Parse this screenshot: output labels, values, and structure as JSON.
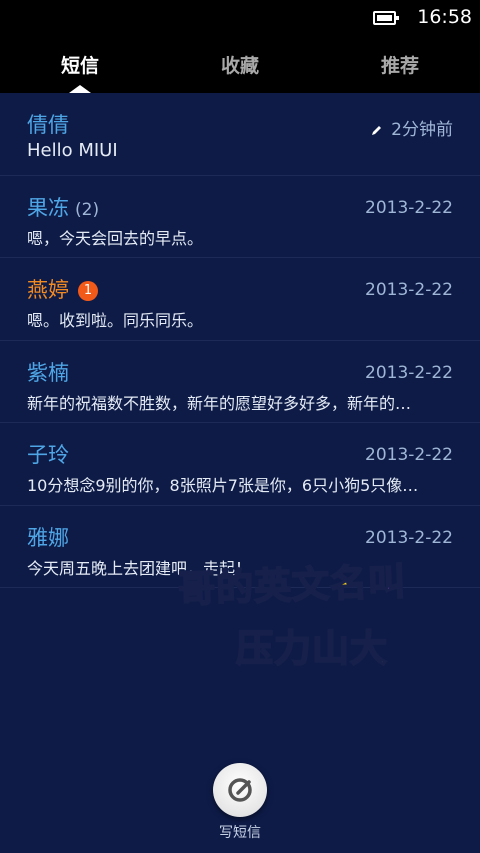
{
  "status_bar": {
    "time": "16:58",
    "battery_icon": "battery-full-icon"
  },
  "tabs": [
    {
      "label": "短信",
      "active": true
    },
    {
      "label": "收藏",
      "active": false
    },
    {
      "label": "推荐",
      "active": false
    }
  ],
  "conversations": [
    {
      "name": "倩倩",
      "count": "",
      "badge": "",
      "time": "2分钟前",
      "draft_icon": "pencil-icon",
      "preview": "Hello MIUI"
    },
    {
      "name": "果冻",
      "count": "(2)",
      "badge": "",
      "time": "2013-2-22",
      "preview": "嗯，今天会回去的早点。"
    },
    {
      "name": "燕婷",
      "count": "",
      "badge": "1",
      "time": "2013-2-22",
      "preview": "嗯。收到啦。同乐同乐。"
    },
    {
      "name": "紫楠",
      "count": "",
      "badge": "",
      "time": "2013-2-22",
      "preview": "新年的祝福数不胜数，新年的愿望好多好多，新年的…"
    },
    {
      "name": "子玲",
      "count": "",
      "badge": "",
      "time": "2013-2-22",
      "preview": "10分想念9别的你，8张照片7张是你，6只小狗5只像…"
    },
    {
      "name": "雅娜",
      "count": "",
      "badge": "",
      "time": "2013-2-22",
      "preview": "今天周五晚上去团建吧，走起！"
    }
  ],
  "overlay": {
    "line1": [
      "哥",
      "的",
      "英",
      "文",
      "名",
      "叫"
    ],
    "line2": [
      "压",
      "力",
      "山",
      "大"
    ],
    "colors1": [
      "#f5a623",
      "#e84393",
      "#8bd645",
      "#2ec4e6",
      "#f5d11a",
      "#b44ee8"
    ],
    "colors2": [
      "#2ec4e6",
      "#f5a623",
      "#e84393",
      "#8bd645"
    ]
  },
  "compose": {
    "label": "写短信",
    "icon": "compose-icon"
  },
  "colors": {
    "background": "#0e1b47",
    "name_blue": "#4fa6e6",
    "name_orange": "#f28a22",
    "badge": "#f25a1a"
  }
}
